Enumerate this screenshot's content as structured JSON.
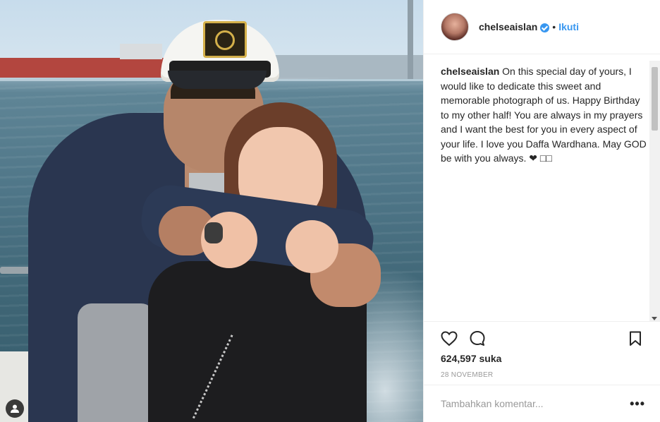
{
  "post": {
    "username": "chelseaislan",
    "follow_label": "Ikuti",
    "separator": "•",
    "caption_user": "chelseaislan",
    "caption_text": " On this special day of yours, I would like to dedicate this sweet and memorable photograph of us. Happy Birthday to my other half! You are always in my prayers and I want the best for you in every aspect of your life. I love you Daffa Wardhana. May GOD be with you always. ❤ □□",
    "likes_text": "624,597 suka",
    "date_text": "28 NOVEMBER",
    "comment_placeholder": "Tambahkan komentar...",
    "more_label": "•••"
  },
  "icons": {
    "verified": "verified-badge-icon",
    "like": "heart-icon",
    "comment": "comment-bubble-icon",
    "save": "bookmark-icon",
    "tag": "user-tag-icon"
  },
  "colors": {
    "accent": "#3897f0",
    "text": "#262626",
    "muted": "#999999",
    "border": "#efefef"
  }
}
